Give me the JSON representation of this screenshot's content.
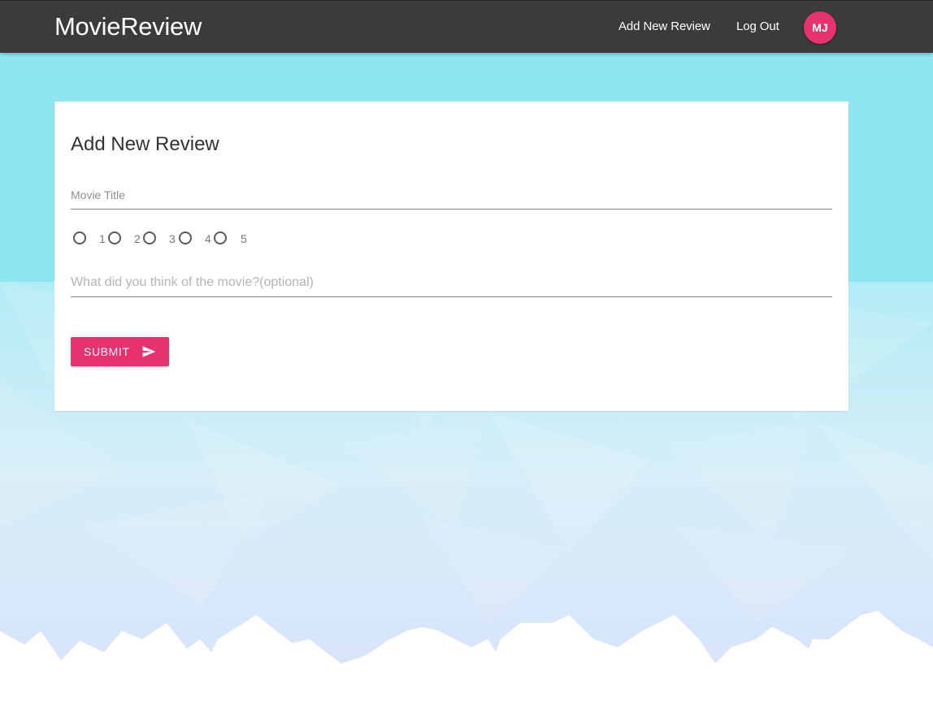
{
  "navbar": {
    "brand": "MovieReview",
    "links": {
      "add_review": "Add New Review",
      "logout": "Log Out"
    },
    "avatar_initials": "MJ",
    "background_color": "#3b3b3b"
  },
  "form": {
    "heading": "Add New Review",
    "movie_title_placeholder": "Movie Title",
    "rating_options": [
      "1",
      "2",
      "3",
      "4",
      "5"
    ],
    "comment_placeholder": "What did you think of the movie?(optional)",
    "submit_label": "SUBMIT",
    "submit_icon": "send-icon"
  },
  "colors": {
    "accent": "#e7336d",
    "top_background": "#8fe6f1",
    "card": "#ffffff"
  }
}
